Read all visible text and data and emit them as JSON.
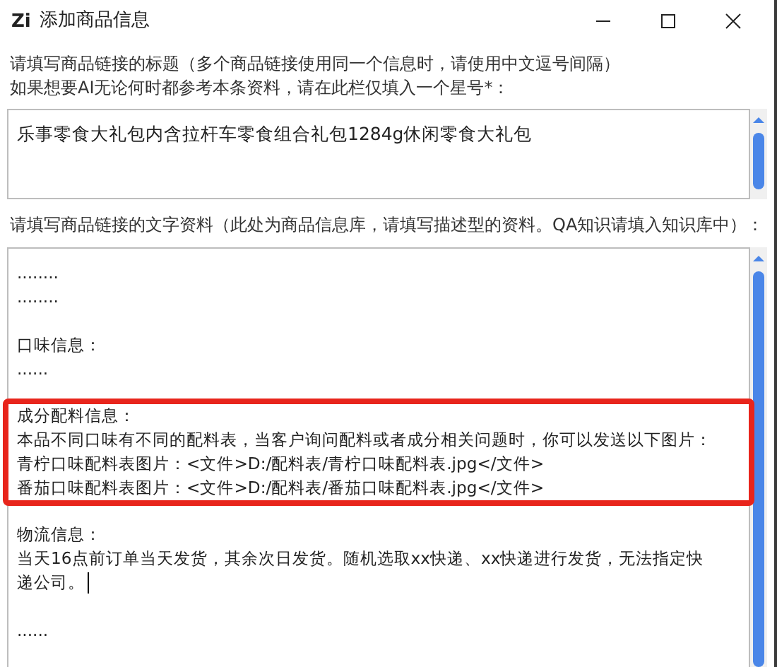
{
  "window": {
    "app_logo": "Zi",
    "title": "添加商品信息"
  },
  "title_field": {
    "label_lines": [
      "请填写商品链接的标题（多个商品链接使用同一个信息时，请使用中文逗号间隔）",
      "如果想要AI无论何时都参考本条资料，请在此栏仅填入一个星号*："
    ],
    "value": "乐事零食大礼包内含拉杆车零食组合礼包1284g休闲零食大礼包"
  },
  "description_field": {
    "label": "请填写商品链接的文字资料（此处为商品信息库，请填写描述型的资料。QA知识请填入知识库中）：",
    "blocks": [
      {
        "lines": [
          "........",
          "........"
        ],
        "highlighted": false,
        "caret": false
      },
      {
        "lines": [
          "口味信息：",
          "......"
        ],
        "highlighted": false,
        "caret": false
      },
      {
        "lines": [
          "成分配料信息：",
          "本品不同口味有不同的配料表，当客户询问配料或者成分相关问题时，你可以发送以下图片：",
          "青柠口味配料表图片：<文件>D:/配料表/青柠口味配料表.jpg</文件>",
          "番茄口味配料表图片：<文件>D:/配料表/番茄口味配料表.jpg</文件>"
        ],
        "highlighted": true,
        "caret": false
      },
      {
        "lines": [
          "物流信息：",
          "当天16点前订单当天发货，其余次日发货。随机选取xx快递、xx快递进行发货，无法指定快递公司。"
        ],
        "highlighted": false,
        "caret": true
      },
      {
        "lines": [
          "......"
        ],
        "highlighted": false,
        "caret": false
      }
    ]
  }
}
